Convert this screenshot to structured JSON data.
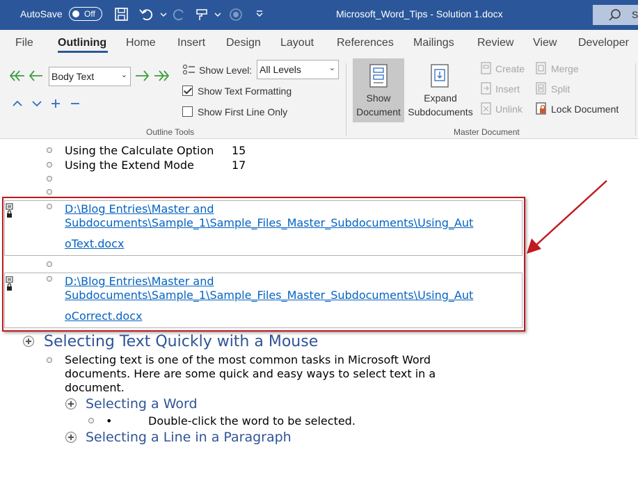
{
  "titlebar": {
    "autosave_label": "AutoSave",
    "autosave_state": "Off",
    "document_title": "Microsoft_Word_Tips - Solution 1.docx",
    "search_placeholder": "S"
  },
  "tabs": [
    {
      "label": "File"
    },
    {
      "label": "Outlining",
      "active": true
    },
    {
      "label": "Home"
    },
    {
      "label": "Insert"
    },
    {
      "label": "Design"
    },
    {
      "label": "Layout"
    },
    {
      "label": "References"
    },
    {
      "label": "Mailings"
    },
    {
      "label": "Review"
    },
    {
      "label": "View"
    },
    {
      "label": "Developer"
    }
  ],
  "outline_tools": {
    "level_value": "Body Text",
    "show_level_label": "Show Level:",
    "show_level_value": "All Levels",
    "show_text_formatting": {
      "label": "Show Text Formatting",
      "checked": true
    },
    "show_first_line_only": {
      "label": "Show First Line Only",
      "checked": false
    },
    "group_label": "Outline Tools"
  },
  "master_document": {
    "show_document_label": "Show Document",
    "expand_subdocuments_label": "Expand Subdocuments",
    "create_label": "Create",
    "insert_label": "Insert",
    "unlink_label": "Unlink",
    "merge_label": "Merge",
    "split_label": "Split",
    "lock_document_label": "Lock Document",
    "group_label": "Master Document"
  },
  "document": {
    "toc_lines": [
      {
        "text": "Using the Calculate Option",
        "page": "15"
      },
      {
        "text": "Using the Extend Mode",
        "page": "17"
      }
    ],
    "subdoc1": {
      "line1": "D:\\Blog Entries\\Master and",
      "line2": "Subdocuments\\Sample_1\\Sample_Files_Master_Subdocuments\\Using_Aut",
      "line3": "oText.docx"
    },
    "subdoc2": {
      "line1": "D:\\Blog Entries\\Master and",
      "line2": "Subdocuments\\Sample_1\\Sample_Files_Master_Subdocuments\\Using_Aut",
      "line3": "oCorrect.docx"
    },
    "heading_selecting_text": "Selecting Text Quickly with a Mouse",
    "para_line1": "Selecting text is one of the most common tasks in Microsoft Word",
    "para_line2": "documents. Here are some quick and easy ways to select text in a",
    "para_line3": "document.",
    "heading_selecting_word": "Selecting a Word",
    "bullet_bullet_char": "•",
    "bullet_text": "Double-click the word to be selected.",
    "heading_selecting_line": "Selecting a Line in a Paragraph"
  },
  "colors": {
    "titlebar": "#2b579a",
    "heading": "#2f5496",
    "link": "#0563c1",
    "callout": "#c0191e"
  }
}
